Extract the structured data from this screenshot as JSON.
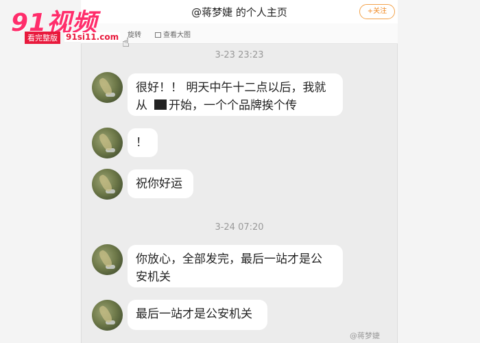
{
  "header": {
    "title": "@蒋梦婕 的个人主页",
    "follow_label": "+关注"
  },
  "toolbar": {
    "rotate_label": "旋转",
    "view_large_label": "查看大图"
  },
  "messages": {
    "timestamp_1": "3-23 23:23",
    "timestamp_2": "3-24 07:20",
    "m1_line1": "很好！！ 明天中午十二点以后，我就",
    "m1_line2_start": "从",
    "m1_line2_end": "开始，一个个品牌挨个传",
    "m2": "！",
    "m3": "祝你好运",
    "m4_line1": "你放心，全部发完，最后一站才是公",
    "m4_line2": "安机关",
    "m5": "最后一站才是公安机关"
  },
  "watermarks": {
    "logo": "91视频",
    "tag": "看完整版",
    "url": "91si11.com",
    "weibo": "@蒋梦婕"
  },
  "icons": [
    "eye-icon",
    "cursor-icon"
  ]
}
